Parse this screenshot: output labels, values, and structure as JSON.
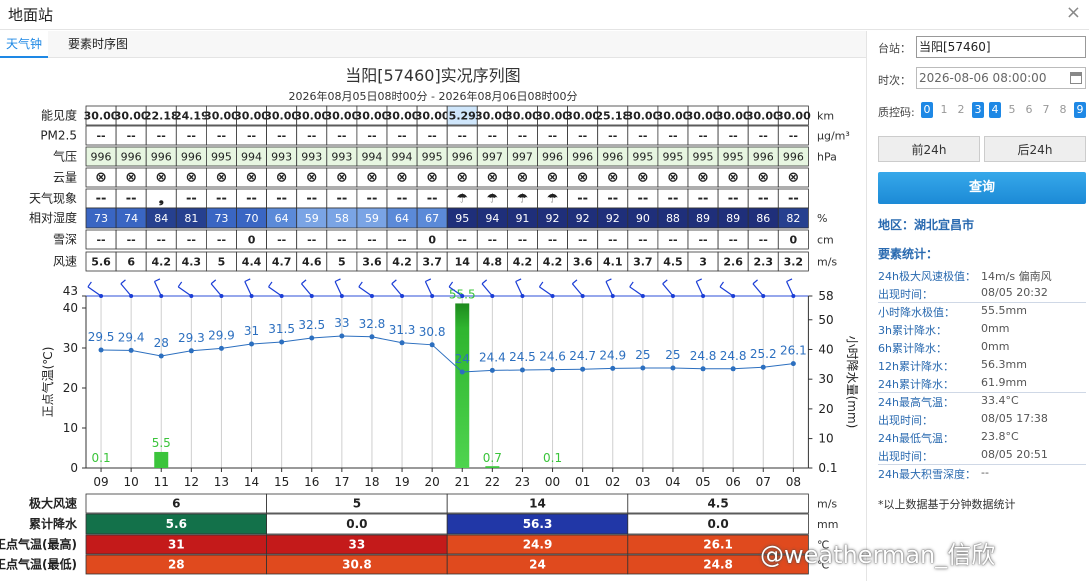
{
  "window": {
    "title": "地面站",
    "close": "×"
  },
  "tabs": [
    "天气钟",
    "要素时序图"
  ],
  "chart_title": "当阳[57460]实况序列图",
  "chart_subtitle": "2026年08月05日08时00分 - 2026年08月06日08时00分",
  "hours": [
    "09",
    "10",
    "11",
    "12",
    "13",
    "14",
    "15",
    "16",
    "17",
    "18",
    "19",
    "20",
    "21",
    "22",
    "23",
    "00",
    "01",
    "02",
    "03",
    "04",
    "05",
    "06",
    "07",
    "08"
  ],
  "rows": {
    "visibility": {
      "label": "能见度",
      "unit": "km",
      "values": [
        "30.00",
        "30.00",
        "22.18",
        "24.19",
        "30.00",
        "30.00",
        "30.00",
        "30.00",
        "30.00",
        "30.00",
        "30.00",
        "30.00",
        "5.29",
        "30.00",
        "30.00",
        "30.00",
        "30.00",
        "25.18",
        "30.00",
        "30.00",
        "30.00",
        "30.00",
        "30.00",
        "30.00"
      ]
    },
    "pm25": {
      "label": "PM2.5",
      "unit": "μg/m³",
      "values": [
        "--",
        "--",
        "--",
        "--",
        "--",
        "--",
        "--",
        "--",
        "--",
        "--",
        "--",
        "--",
        "--",
        "--",
        "--",
        "--",
        "--",
        "--",
        "--",
        "--",
        "--",
        "--",
        "--",
        "--"
      ]
    },
    "pressure": {
      "label": "气压",
      "unit": "hPa",
      "values": [
        "996",
        "996",
        "996",
        "996",
        "995",
        "994",
        "993",
        "993",
        "993",
        "994",
        "994",
        "995",
        "996",
        "997",
        "997",
        "996",
        "996",
        "996",
        "995",
        "995",
        "995",
        "995",
        "996",
        "996"
      ]
    },
    "cloud": {
      "label": "云量",
      "unit": "",
      "values": [
        "⊗",
        "⊗",
        "⊗",
        "⊗",
        "⊗",
        "⊗",
        "⊗",
        "⊗",
        "⊗",
        "⊗",
        "⊗",
        "⊗",
        "⊗",
        "⊗",
        "⊗",
        "⊗",
        "⊗",
        "⊗",
        "⊗",
        "⊗",
        "⊗",
        "⊗",
        "⊗",
        "⊗"
      ]
    },
    "weather": {
      "label": "天气现象",
      "unit": "",
      "values": [
        "--",
        "--",
        "❟",
        "--",
        "--",
        "--",
        "--",
        "--",
        "--",
        "--",
        "--",
        "--",
        "☂",
        "☂",
        "☂",
        "☂",
        "--",
        "--",
        "--",
        "--",
        "--",
        "--",
        "--",
        "--"
      ]
    },
    "humidity": {
      "label": "相对湿度",
      "unit": "%",
      "values": [
        "73",
        "74",
        "84",
        "81",
        "73",
        "70",
        "64",
        "59",
        "58",
        "59",
        "64",
        "67",
        "95",
        "94",
        "91",
        "92",
        "92",
        "92",
        "90",
        "88",
        "89",
        "89",
        "86",
        "82"
      ]
    },
    "snow": {
      "label": "雪深",
      "unit": "cm",
      "values": [
        "--",
        "--",
        "--",
        "--",
        "--",
        "0",
        "--",
        "--",
        "--",
        "--",
        "--",
        "0",
        "--",
        "--",
        "--",
        "--",
        "--",
        "--",
        "--",
        "--",
        "--",
        "--",
        "--",
        "0"
      ]
    },
    "wind": {
      "label": "风速",
      "unit": "m/s",
      "values": [
        "5.6",
        "6",
        "4.2",
        "4.3",
        "5",
        "4.4",
        "4.7",
        "4.6",
        "5",
        "3.6",
        "4.2",
        "3.7",
        "14",
        "4.8",
        "4.2",
        "4.2",
        "3.6",
        "4.1",
        "3.7",
        "4.5",
        "3",
        "2.6",
        "2.3",
        "3.2"
      ]
    }
  },
  "chart_data": {
    "type": "line",
    "x": [
      "09",
      "10",
      "11",
      "12",
      "13",
      "14",
      "15",
      "16",
      "17",
      "18",
      "19",
      "20",
      "21",
      "22",
      "23",
      "00",
      "01",
      "02",
      "03",
      "04",
      "05",
      "06",
      "07",
      "08"
    ],
    "series": [
      {
        "values": [
          29.5,
          29.4,
          28,
          29.3,
          29.9,
          31,
          31.5,
          32.5,
          33,
          32.8,
          31.3,
          30.8,
          24,
          24.4,
          24.5,
          24.6,
          24.7,
          24.9,
          25,
          25,
          24.8,
          24.8,
          25.2,
          26.1
        ]
      },
      {
        "values": [
          0.1,
          0,
          5.5,
          0,
          0,
          0,
          0,
          0,
          0,
          0,
          0,
          0,
          55.5,
          0.7,
          0,
          0.1,
          0,
          0,
          0,
          0,
          0,
          0,
          0,
          0
        ]
      }
    ],
    "ylabel": "正点气温(℃)",
    "y2label": "小时降水量(mm)",
    "ylim": [
      0,
      43
    ],
    "y2lim": [
      0.1,
      58
    ],
    "yticks": [
      "0",
      "10",
      "20",
      "30",
      "40",
      "43"
    ],
    "y2ticks": [
      "0.1",
      "10",
      "20",
      "30",
      "40",
      "50",
      "58"
    ],
    "precip_labels": [
      "0.1",
      "",
      "5.5",
      "",
      "",
      "",
      "",
      "",
      "",
      "",
      "",
      "",
      "55.5",
      "0.7",
      "",
      "0.1",
      "",
      "",
      "",
      "",
      "",
      "",
      "",
      ""
    ],
    "colors": {
      "temp": "#2c6fbf",
      "precip": "#3bc43b",
      "label": "#2c6fbf"
    }
  },
  "summary": {
    "rows": [
      {
        "label": "极大风速",
        "unit": "m/s",
        "values": [
          "6",
          "5",
          "14",
          "4.5"
        ]
      },
      {
        "label": "累计降水",
        "unit": "mm",
        "values": [
          "5.6",
          "0.0",
          "56.3",
          "0.0"
        ],
        "colors": [
          "#13714a",
          "#ffffff",
          "#2137a7",
          "#ffffff"
        ],
        "text_colors": [
          "#fff",
          "#222",
          "#fff",
          "#222"
        ]
      },
      {
        "label": "正点气温(最高)",
        "unit": "℃",
        "values": [
          "31",
          "33",
          "24.9",
          "26.1"
        ],
        "colors": [
          "#c41a1a",
          "#c41a1a",
          "#e04a1e",
          "#e04a1e"
        ],
        "text_colors": [
          "#fff",
          "#fff",
          "#fff",
          "#fff"
        ]
      },
      {
        "label": "正点气温(最低)",
        "unit": "℃",
        "values": [
          "28",
          "30.8",
          "24",
          "24.8"
        ],
        "colors": [
          "#e04a1e",
          "#e04a1e",
          "#e04a1e",
          "#e04a1e"
        ],
        "text_colors": [
          "#fff",
          "#fff",
          "#fff",
          "#fff"
        ]
      }
    ]
  },
  "sidebar": {
    "station_label": "台站：",
    "station_value": "当阳[57460]",
    "time_label": "时次：",
    "time_value": "2026-08-06 08:00:00",
    "qc_label": "质控码:",
    "qc_codes": [
      {
        "v": "0",
        "on": true
      },
      {
        "v": "1",
        "on": false
      },
      {
        "v": "2",
        "on": false
      },
      {
        "v": "3",
        "on": true
      },
      {
        "v": "4",
        "on": true
      },
      {
        "v": "5",
        "on": false
      },
      {
        "v": "6",
        "on": false
      },
      {
        "v": "7",
        "on": false
      },
      {
        "v": "8",
        "on": false
      },
      {
        "v": "9",
        "on": true
      }
    ],
    "prev_btn": "前24h",
    "next_btn": "后24h",
    "query_btn": "查询",
    "region": "地区：湖北宜昌市",
    "stats_title": "要素统计：",
    "stats": [
      {
        "k": "24h极大风速极值：",
        "v": "14m/s 偏南风"
      },
      {
        "k": "出现时间：",
        "v": "08/05 20:32"
      },
      {
        "k": "小时降水极值：",
        "v": "55.5mm"
      },
      {
        "k": "3h累计降水：",
        "v": "0mm"
      },
      {
        "k": "6h累计降水：",
        "v": "0mm"
      },
      {
        "k": "12h累计降水：",
        "v": "56.3mm"
      },
      {
        "k": "24h累计降水：",
        "v": "61.9mm"
      },
      {
        "k": "24h最高气温：",
        "v": "33.4°C"
      },
      {
        "k": "出现时间：",
        "v": "08/05 17:38"
      },
      {
        "k": "24h最低气温：",
        "v": "23.8°C"
      },
      {
        "k": "出现时间：",
        "v": "08/05 20:51"
      },
      {
        "k": "24h最大积雪深度：",
        "v": "--"
      }
    ],
    "footnote": "*以上数据基于分钟数据统计"
  },
  "watermark": "@weatherman_信欣"
}
